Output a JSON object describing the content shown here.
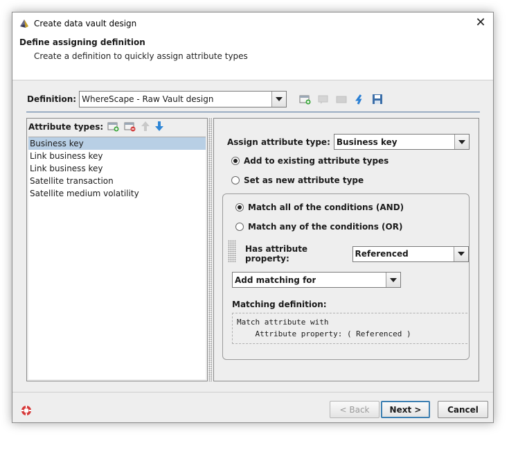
{
  "window": {
    "title": "Create data vault design"
  },
  "header": {
    "title": "Define assigning definition",
    "subtitle": "Create a definition to quickly assign attribute types"
  },
  "definition": {
    "label": "Definition:",
    "value": "WhereScape - Raw Vault design",
    "toolbar_icons": [
      "add-definition-icon",
      "comment-icon",
      "message-icon",
      "refresh-icon",
      "save-icon"
    ]
  },
  "attribute_types": {
    "label": "Attribute types:",
    "items": [
      {
        "label": "Business key",
        "selected": true
      },
      {
        "label": "Link business key",
        "selected": false
      },
      {
        "label": "Link business key",
        "selected": false
      },
      {
        "label": "Satellite transaction",
        "selected": false
      },
      {
        "label": "Satellite medium volatility",
        "selected": false
      }
    ]
  },
  "assign": {
    "label": "Assign attribute type:",
    "value": "Business key",
    "option_existing": "Add to existing attribute types",
    "option_new": "Set as new attribute type"
  },
  "conditions": {
    "match_all": "Match all of the conditions (AND)",
    "match_any": "Match any of the conditions (OR)",
    "property_label": "Has attribute property:",
    "property_value": "Referenced",
    "add_matching": "Add matching for",
    "matching_def_label": "Matching definition:",
    "matching_def_line1": "Match attribute with",
    "matching_def_line2": "    Attribute property: ( Referenced )"
  },
  "buttons": {
    "back": "< Back",
    "next": "Next >",
    "cancel": "Cancel"
  }
}
